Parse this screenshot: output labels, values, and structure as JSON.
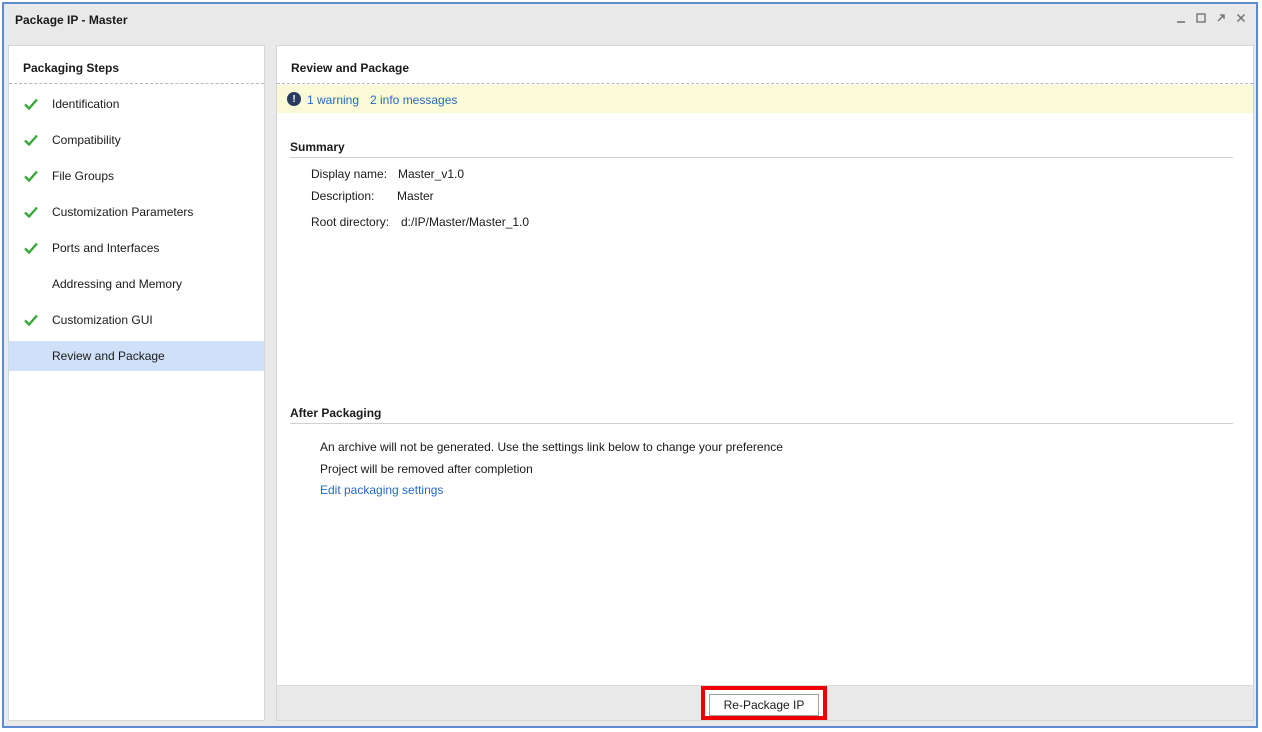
{
  "window": {
    "title": "Package IP - Master",
    "controls": [
      "minimize-icon",
      "maximize-icon",
      "restore-icon",
      "close-icon"
    ]
  },
  "left": {
    "title": "Packaging Steps",
    "steps": [
      {
        "label": "Identification",
        "checked": true
      },
      {
        "label": "Compatibility",
        "checked": true
      },
      {
        "label": "File Groups",
        "checked": true
      },
      {
        "label": "Customization Parameters",
        "checked": true
      },
      {
        "label": "Ports and Interfaces",
        "checked": true
      },
      {
        "label": "Addressing and Memory",
        "checked": false
      },
      {
        "label": "Customization GUI",
        "checked": true
      },
      {
        "label": "Review and Package",
        "checked": false,
        "active": true
      }
    ]
  },
  "right": {
    "title": "Review and Package",
    "messages": {
      "warning": "1 warning",
      "info": "2 info messages"
    },
    "summary": {
      "title": "Summary",
      "display_name_label": "Display name:",
      "display_name_value": "Master_v1.0",
      "description_label": "Description:",
      "description_value": "Master",
      "root_dir_label": "Root directory:",
      "root_dir_value": "d:/IP/Master/Master_1.0"
    },
    "after": {
      "title": "After Packaging",
      "line1": "An archive will not be generated. Use the settings link below to change your preference",
      "line2": "Project will be removed after completion",
      "link": "Edit packaging settings"
    },
    "button": "Re-Package IP"
  },
  "colors": {
    "accent_link": "#2469c8",
    "check_green": "#3aa83a",
    "highlight_red": "#ee0000",
    "active_row": "#cfe1f9",
    "message_bar": "#fafad7",
    "window_border": "#5d8bd1"
  }
}
